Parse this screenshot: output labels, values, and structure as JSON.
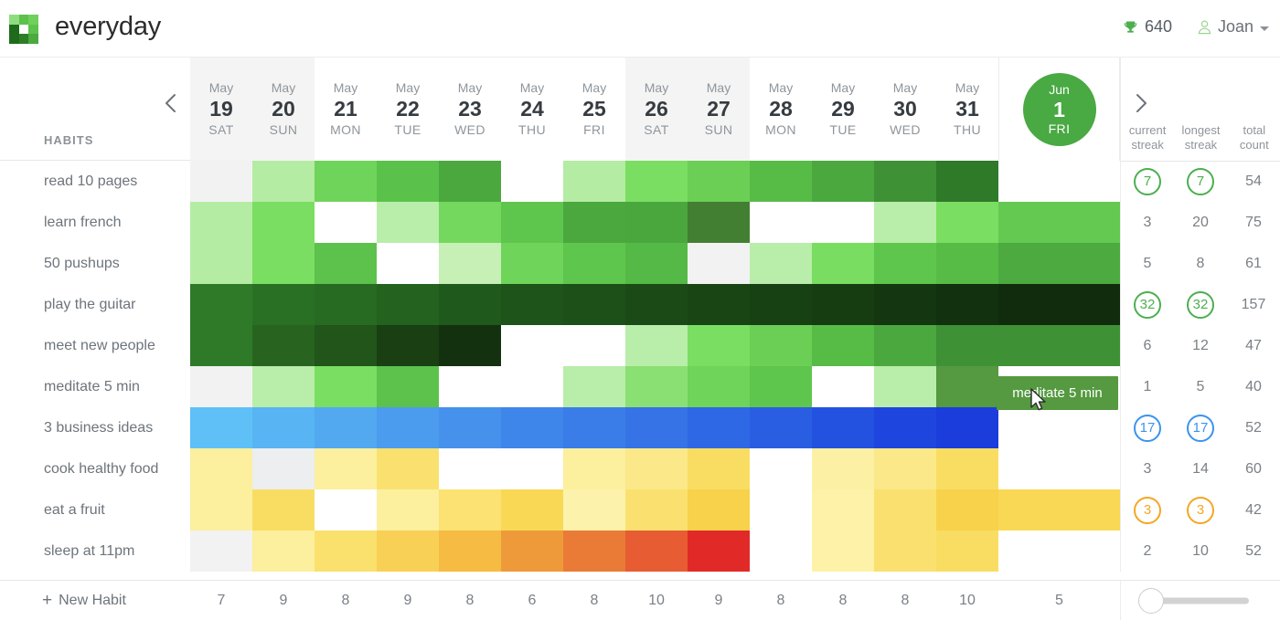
{
  "app": {
    "brand": "everyday",
    "logo_icon": "logo-squares-icon",
    "logo_colors": [
      "#8fdc7e",
      "#5cc24c",
      "#6fd05c",
      "#1f6b1c",
      "#ffffff",
      "#5cc24c",
      "#1f6b1c",
      "#2f7d27",
      "#4aa93f"
    ]
  },
  "header": {
    "trophy_icon": "trophy-icon",
    "points": "640",
    "user_icon": "user-icon",
    "user_name": "Joan",
    "caret_icon": "chevron-down-icon",
    "accent_green": "#4caf50"
  },
  "sidebar": {
    "habits_label": "HABITS",
    "new_habit_label": "New Habit",
    "new_habit_icon": "plus-icon"
  },
  "nav": {
    "prev_icon": "chevron-left-icon",
    "next_icon": "chevron-right-icon"
  },
  "stats_header": [
    {
      "line1": "current",
      "line2": "streak"
    },
    {
      "line1": "longest",
      "line2": "streak"
    },
    {
      "line1": "total",
      "line2": "count"
    }
  ],
  "days": [
    {
      "month": "May",
      "num": "19",
      "dow": "SAT",
      "weekend": true
    },
    {
      "month": "May",
      "num": "20",
      "dow": "SUN",
      "weekend": true
    },
    {
      "month": "May",
      "num": "21",
      "dow": "MON",
      "weekend": false
    },
    {
      "month": "May",
      "num": "22",
      "dow": "TUE",
      "weekend": false
    },
    {
      "month": "May",
      "num": "23",
      "dow": "WED",
      "weekend": false
    },
    {
      "month": "May",
      "num": "24",
      "dow": "THU",
      "weekend": false
    },
    {
      "month": "May",
      "num": "25",
      "dow": "FRI",
      "weekend": false
    },
    {
      "month": "May",
      "num": "26",
      "dow": "SAT",
      "weekend": true
    },
    {
      "month": "May",
      "num": "27",
      "dow": "SUN",
      "weekend": true
    },
    {
      "month": "May",
      "num": "28",
      "dow": "MON",
      "weekend": false
    },
    {
      "month": "May",
      "num": "29",
      "dow": "TUE",
      "weekend": false
    },
    {
      "month": "May",
      "num": "30",
      "dow": "WED",
      "weekend": false
    },
    {
      "month": "May",
      "num": "31",
      "dow": "THU",
      "weekend": false
    }
  ],
  "today": {
    "month": "Jun",
    "num": "1",
    "dow": "FRI",
    "color": "#49a942"
  },
  "habits": [
    {
      "name": "read 10 pages",
      "current_streak": "7",
      "longest_streak": "7",
      "total_count": "54",
      "highlight": true,
      "badge_color": "#4caf50",
      "cells": [
        "#f2f2f2",
        "#b5eca3",
        "#6fd45a",
        "#5ac24a",
        "#4ba83e",
        "#ffffff",
        "#b5eca3",
        "#7ade62",
        "#6ccf55",
        "#57bc45",
        "#4ba83e",
        "#3f9135",
        "#2e7a28",
        ""
      ]
    },
    {
      "name": "learn french",
      "current_streak": "3",
      "longest_streak": "20",
      "total_count": "75",
      "highlight": false,
      "badge_color": "#4caf50",
      "cells": [
        "#b5eca3",
        "#7ade62",
        "#ffffff",
        "#b9edaa",
        "#74d85e",
        "#5ec64d",
        "#4ba83e",
        "#4aa73d",
        "#427f32",
        "#ffffff",
        "#ffffff",
        "#b9edaa",
        "#7ade62",
        "#63c951"
      ]
    },
    {
      "name": "50 pushups",
      "current_streak": "5",
      "longest_streak": "8",
      "total_count": "61",
      "highlight": false,
      "badge_color": "#4caf50",
      "cells": [
        "#b5eca3",
        "#7ade62",
        "#5cc24c",
        "#ffffff",
        "#c6f0b6",
        "#6fd45a",
        "#5ec64d",
        "#54b946",
        "#f2f2f2",
        "#b9edaa",
        "#79dd61",
        "#5ec64d",
        "#57bc45",
        "#4daa40"
      ]
    },
    {
      "name": "play the guitar",
      "current_streak": "32",
      "longest_streak": "32",
      "total_count": "157",
      "highlight": true,
      "badge_color": "#4caf50",
      "cells": [
        "#2e7a28",
        "#2a7024",
        "#276a22",
        "#24621f",
        "#20591c",
        "#1e5319",
        "#1d4f18",
        "#1b4a16",
        "#194515",
        "#184113",
        "#163c12",
        "#143610",
        "#12310e",
        "#102c0d"
      ]
    },
    {
      "name": "meet new people",
      "current_streak": "6",
      "longest_streak": "12",
      "total_count": "47",
      "highlight": false,
      "badge_color": "#4caf50",
      "cells": [
        "#2e7a28",
        "#28641f",
        "#21551a",
        "#193f13",
        "#14310f",
        "#ffffff",
        "#ffffff",
        "#b9edaa",
        "#7ade62",
        "#6ccf55",
        "#57bc45",
        "#4ba83e",
        "#3f9135",
        "#3f9135"
      ]
    },
    {
      "name": "meditate 5 min",
      "current_streak": "1",
      "longest_streak": "5",
      "total_count": "40",
      "highlight": false,
      "badge_color": "#4caf50",
      "cells": [
        "#f2f2f2",
        "#b9edaa",
        "#7ade62",
        "#5cc24c",
        "#ffffff",
        "#ffffff",
        "#b9edaa",
        "#8ae072",
        "#6fd45a",
        "#5ec64d",
        "#ffffff",
        "#b9edaa",
        "#559940",
        ""
      ]
    },
    {
      "name": "3 business ideas",
      "current_streak": "17",
      "longest_streak": "17",
      "total_count": "52",
      "highlight": true,
      "badge_color": "#3b93ee",
      "cells": [
        "#5ec0f7",
        "#58b4f3",
        "#52a9f0",
        "#4b9cee",
        "#4591ec",
        "#3f86ea",
        "#3a7de8",
        "#3573e6",
        "#2f68e4",
        "#2a5ee2",
        "#2452e0",
        "#1e46de",
        "#1a3ddc",
        ""
      ]
    },
    {
      "name": "cook healthy food",
      "current_streak": "3",
      "longest_streak": "14",
      "total_count": "60",
      "highlight": false,
      "badge_color": "#f5a623",
      "cells": [
        "#fcef9e",
        "#eceef0",
        "#fcef9e",
        "#fae16f",
        "#ffffff",
        "#ffffff",
        "#fcef9e",
        "#fbe888",
        "#f9dd63",
        "#ffffff",
        "#fcf0a4",
        "#fbe888",
        "#f9dd63",
        ""
      ]
    },
    {
      "name": "eat a fruit",
      "current_streak": "3",
      "longest_streak": "3",
      "total_count": "42",
      "highlight": true,
      "badge_color": "#f5a623",
      "cells": [
        "#fcef9e",
        "#f9dd63",
        "#ffffff",
        "#fcef9e",
        "#fbe272",
        "#f8d855",
        "#fcf2ab",
        "#fae16f",
        "#f7d24a",
        "#ffffff",
        "#fdf2a8",
        "#fae16f",
        "#f7d24a",
        "#f8d855"
      ]
    },
    {
      "name": "sleep at 11pm",
      "current_streak": "2",
      "longest_streak": "10",
      "total_count": "52",
      "highlight": false,
      "badge_color": "#f5a623",
      "cells": [
        "#f2f2f2",
        "#fcef9e",
        "#fae06c",
        "#f8d055",
        "#f5bb42",
        "#ef9a3a",
        "#ea7b36",
        "#e75c32",
        "#e12a27",
        "#ffffff",
        "#fdf2a8",
        "#fae16f",
        "#f9dd63",
        ""
      ]
    }
  ],
  "totals": [
    "7",
    "9",
    "8",
    "9",
    "8",
    "6",
    "8",
    "10",
    "9",
    "8",
    "8",
    "8",
    "10",
    "5"
  ],
  "tooltip": {
    "text": "meditate 5 min",
    "bg": "#559940"
  },
  "slider": {
    "position": "0"
  }
}
